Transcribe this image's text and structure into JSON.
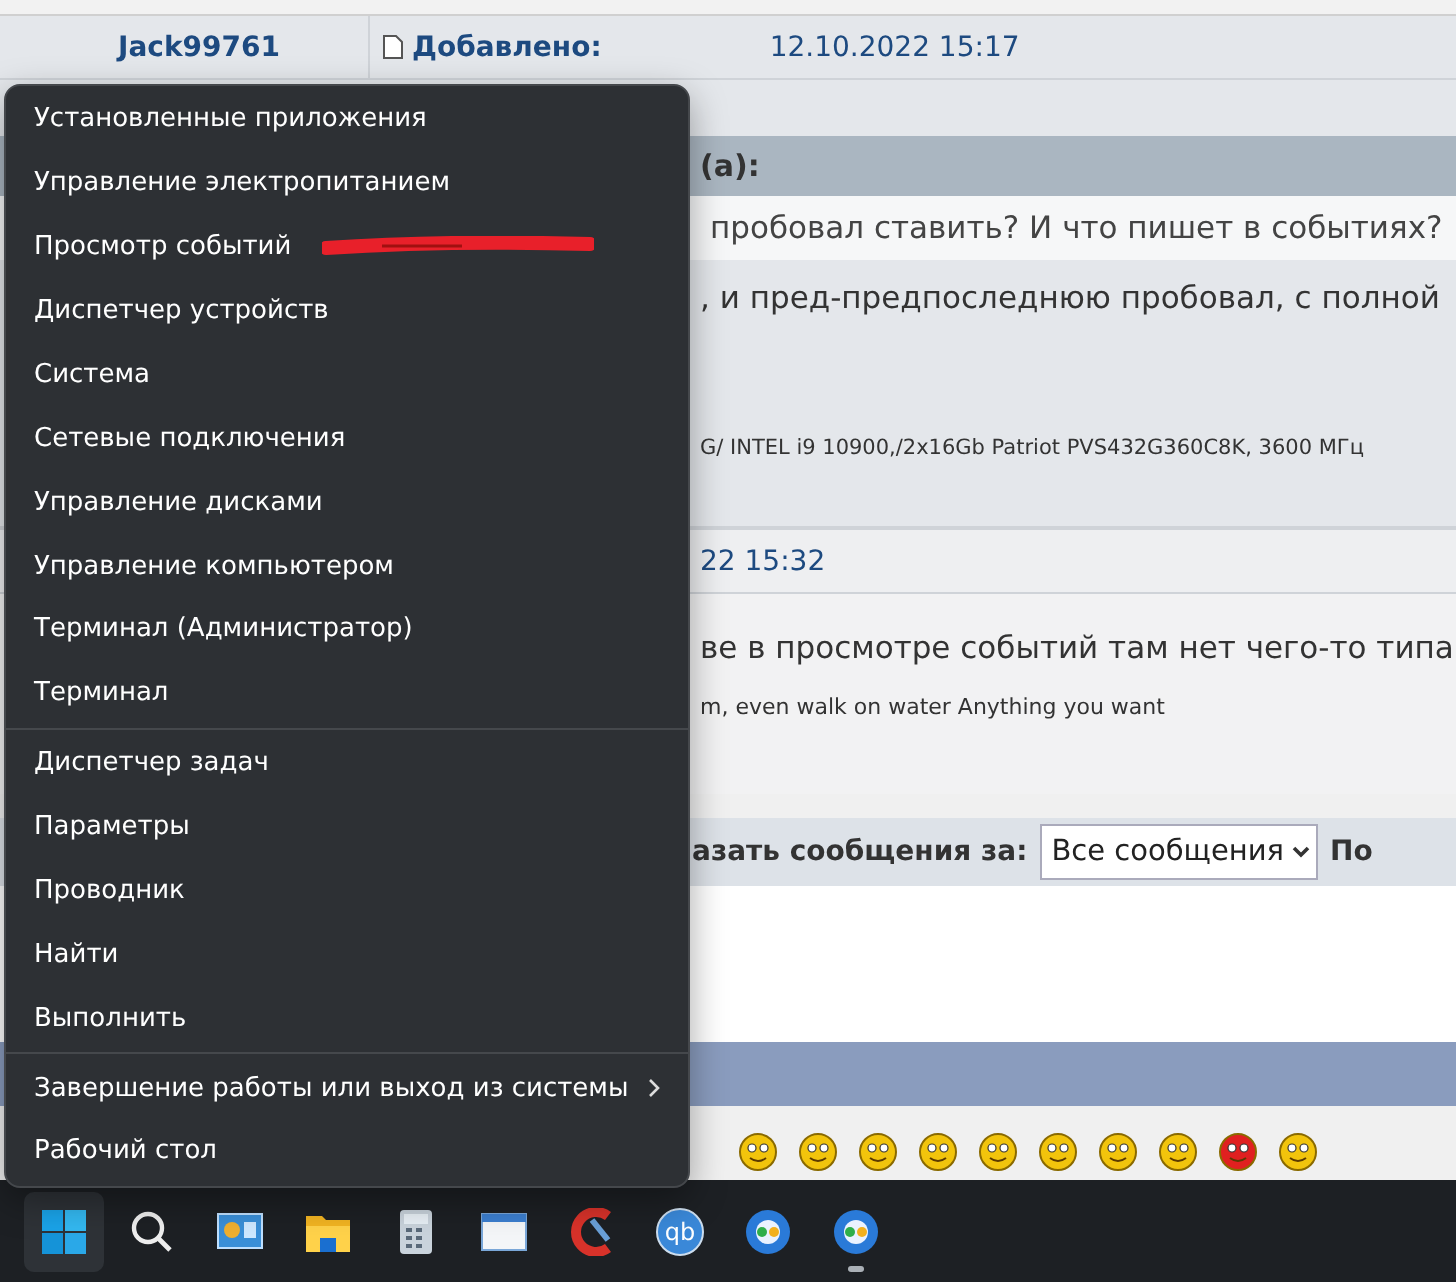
{
  "forum": {
    "author": "Jack99761",
    "posted_label": "Добавлено:",
    "posted_date": "12.10.2022 15:17",
    "quote_header": "(а):",
    "quote_text": "пробовал ставить? И что пишет в событиях?",
    "post_text": ", и пред-предпоследнюю пробовал, с полной",
    "signature": "G/ INTEL i9 10900,/2x16Gb Patriot PVS432G360C8K, 3600 МГц",
    "reply_date": "22 15:32",
    "reply_text": "ве в просмотре событий там нет чего-то типа",
    "reply_signature": "m, even walk on water Anything you want",
    "filter_label": "азать сообщения за:",
    "filter_value": "Все сообщения",
    "filter_next": "По"
  },
  "menu": {
    "items": [
      {
        "label": "Установленные приложения",
        "submenu": false,
        "group_end": false
      },
      {
        "label": "Управление электропитанием",
        "submenu": false,
        "group_end": false
      },
      {
        "label": "Просмотр событий",
        "submenu": false,
        "group_end": false
      },
      {
        "label": "Диспетчер устройств",
        "submenu": false,
        "group_end": false
      },
      {
        "label": "Система",
        "submenu": false,
        "group_end": false
      },
      {
        "label": "Сетевые подключения",
        "submenu": false,
        "group_end": false
      },
      {
        "label": "Управление дисками",
        "submenu": false,
        "group_end": false
      },
      {
        "label": "Управление компьютером",
        "submenu": false,
        "group_end": false
      },
      {
        "label": "Терминал (Администратор)",
        "submenu": false,
        "group_end": false
      },
      {
        "label": "Терминал",
        "submenu": false,
        "group_end": true
      },
      {
        "label": "Диспетчер задач",
        "submenu": false,
        "group_end": false
      },
      {
        "label": "Параметры",
        "submenu": false,
        "group_end": false
      },
      {
        "label": "Проводник",
        "submenu": false,
        "group_end": false
      },
      {
        "label": "Найти",
        "submenu": false,
        "group_end": false
      },
      {
        "label": "Выполнить",
        "submenu": false,
        "group_end": true
      },
      {
        "label": "Завершение работы или выход из системы",
        "submenu": true,
        "group_end": false
      },
      {
        "label": "Рабочий стол",
        "submenu": false,
        "group_end": false
      }
    ]
  },
  "taskbar": {
    "items": [
      {
        "kind": "start",
        "selected": true,
        "running": false
      },
      {
        "kind": "search",
        "selected": false,
        "running": false
      },
      {
        "kind": "monitor",
        "selected": false,
        "running": false
      },
      {
        "kind": "folder",
        "selected": false,
        "running": false
      },
      {
        "kind": "calculator",
        "selected": false,
        "running": false
      },
      {
        "kind": "window",
        "selected": false,
        "running": false
      },
      {
        "kind": "cleaner",
        "selected": false,
        "running": false
      },
      {
        "kind": "torrent",
        "label": "qb",
        "selected": false,
        "running": false
      },
      {
        "kind": "browser",
        "selected": false,
        "running": false
      },
      {
        "kind": "browser",
        "selected": false,
        "running": true
      }
    ]
  }
}
